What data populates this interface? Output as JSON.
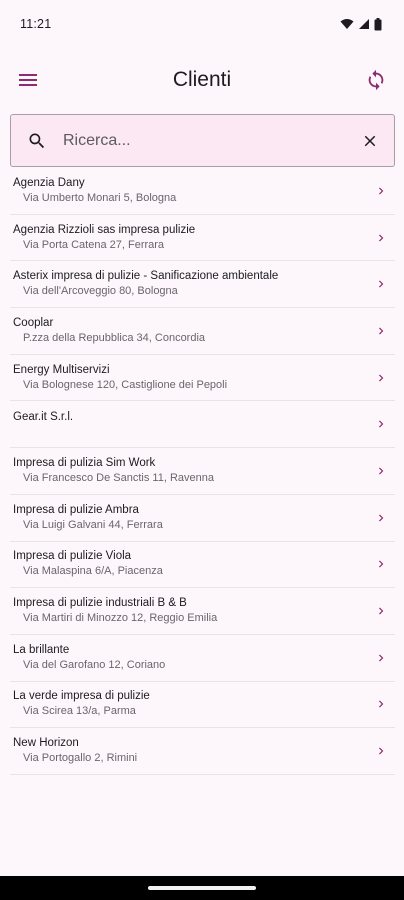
{
  "status_bar": {
    "time": "11:21"
  },
  "app_bar": {
    "title": "Clienti"
  },
  "search": {
    "placeholder": "Ricerca...",
    "value": ""
  },
  "clients": [
    {
      "name": "Agenzia Dany",
      "address": "Via Umberto Monari 5, Bologna"
    },
    {
      "name": "Agenzia Rizzioli sas impresa pulizie",
      "address": "Via Porta Catena 27, Ferrara"
    },
    {
      "name": "Asterix impresa di pulizie - Sanificazione ambientale",
      "address": "Via dell'Arcoveggio 80, Bologna"
    },
    {
      "name": "Cooplar",
      "address": "P.zza della Repubblica 34, Concordia"
    },
    {
      "name": "Energy Multiservizi",
      "address": "Via Bolognese 120, Castiglione dei Pepoli"
    },
    {
      "name": "Gear.it S.r.l.",
      "address": ""
    },
    {
      "name": "Impresa di pulizia Sim Work",
      "address": "Via Francesco De Sanctis 11, Ravenna"
    },
    {
      "name": "Impresa di pulizie Ambra",
      "address": "Via Luigi Galvani 44, Ferrara"
    },
    {
      "name": "Impresa di pulizie Viola",
      "address": "Via Malaspina 6/A, Piacenza"
    },
    {
      "name": "Impresa di pulizie industriali B & B",
      "address": "Via Martiri di Minozzo 12, Reggio Emilia"
    },
    {
      "name": "La brillante",
      "address": "Via del Garofano 12, Coriano"
    },
    {
      "name": "La verde impresa di pulizie",
      "address": "Via Scirea 13/a, Parma"
    },
    {
      "name": "New Horizon",
      "address": "Via Portogallo 2, Rimini"
    }
  ],
  "colors": {
    "accent": "#8e2a6e",
    "background": "#fdf7fb",
    "search_background": "#fce8f2"
  },
  "icons": {
    "menu": "menu-icon",
    "sync": "sync-icon",
    "search": "search-icon",
    "clear": "close-icon",
    "row_action": "chevron-right-icon"
  }
}
